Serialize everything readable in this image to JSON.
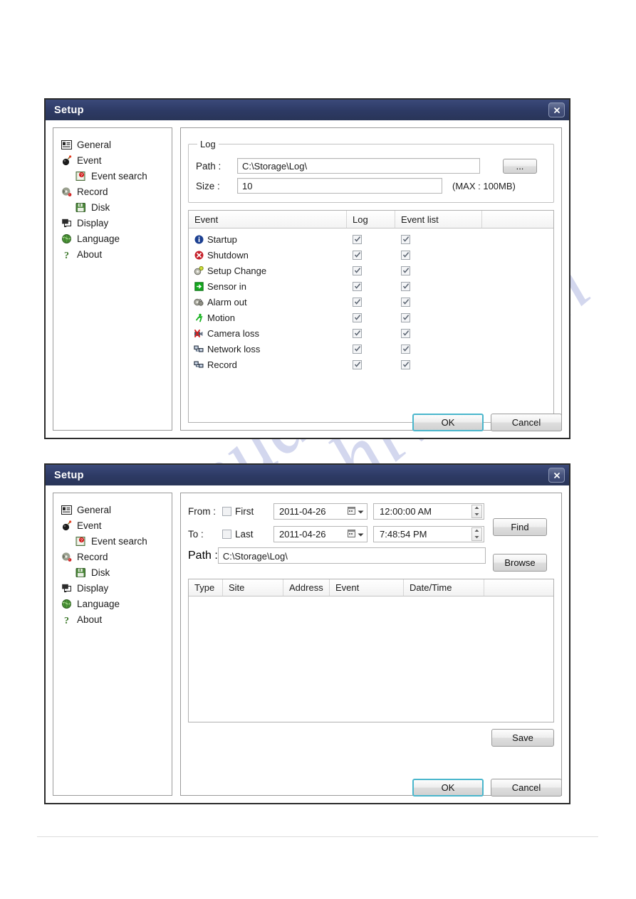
{
  "watermark": {
    "line1": "manualshive",
    "line2": "shive.com"
  },
  "dialogs": [
    {
      "title": "Setup",
      "close_icon": "close-icon",
      "sidebar": [
        {
          "label": "General",
          "icon": "general-icon",
          "indent": false
        },
        {
          "label": "Event",
          "icon": "event-bomb-icon",
          "indent": false
        },
        {
          "label": "Event search",
          "icon": "event-search-icon",
          "indent": true
        },
        {
          "label": "Record",
          "icon": "record-icon",
          "indent": false
        },
        {
          "label": "Disk",
          "icon": "disk-icon",
          "indent": true
        },
        {
          "label": "Display",
          "icon": "display-icon",
          "indent": false
        },
        {
          "label": "Language",
          "icon": "language-globe-icon",
          "indent": false
        },
        {
          "label": "About",
          "icon": "about-help-icon",
          "indent": false
        }
      ],
      "log_group": {
        "legend": "Log",
        "path_label": "Path :",
        "path_value": "C:\\Storage\\Log\\",
        "browse_label": "...",
        "size_label": "Size :",
        "size_value": "10",
        "max_note": "(MAX : 100MB)"
      },
      "event_table": {
        "columns": [
          "Event",
          "Log",
          "Event list",
          ""
        ],
        "rows": [
          {
            "name": "Startup",
            "icon": "info-circle-icon",
            "log": true,
            "event_list": true
          },
          {
            "name": "Shutdown",
            "icon": "error-circle-icon",
            "log": true,
            "event_list": true
          },
          {
            "name": "Setup Change",
            "icon": "gear-settings-icon",
            "log": true,
            "event_list": true
          },
          {
            "name": "Sensor in",
            "icon": "sensor-arrow-icon",
            "log": true,
            "event_list": true
          },
          {
            "name": "Alarm out",
            "icon": "alarm-gear-icon",
            "log": true,
            "event_list": true
          },
          {
            "name": "Motion",
            "icon": "motion-runner-icon",
            "log": true,
            "event_list": true
          },
          {
            "name": "Camera loss",
            "icon": "camera-loss-icon",
            "log": true,
            "event_list": true
          },
          {
            "name": "Network loss",
            "icon": "network-loss-icon",
            "log": true,
            "event_list": true
          },
          {
            "name": "Record",
            "icon": "network-record-icon",
            "log": true,
            "event_list": true
          }
        ]
      },
      "footer": {
        "ok": "OK",
        "cancel": "Cancel"
      }
    },
    {
      "title": "Setup",
      "close_icon": "close-icon",
      "sidebar": [
        {
          "label": "General",
          "icon": "general-icon",
          "indent": false
        },
        {
          "label": "Event",
          "icon": "event-bomb-icon",
          "indent": false
        },
        {
          "label": "Event search",
          "icon": "event-search-icon",
          "indent": true
        },
        {
          "label": "Record",
          "icon": "record-icon",
          "indent": false
        },
        {
          "label": "Disk",
          "icon": "disk-icon",
          "indent": true
        },
        {
          "label": "Display",
          "icon": "display-icon",
          "indent": false
        },
        {
          "label": "Language",
          "icon": "language-globe-icon",
          "indent": false
        },
        {
          "label": "About",
          "icon": "about-help-icon",
          "indent": false
        }
      ],
      "search": {
        "from_label": "From :",
        "from_checkbox_label": "First",
        "from_checked": false,
        "from_date": "2011-04-26",
        "from_time": "12:00:00 AM",
        "to_label": "To :",
        "to_checkbox_label": "Last",
        "to_checked": false,
        "to_date": "2011-04-26",
        "to_time": "7:48:54 PM",
        "path_label": "Path  :",
        "path_value": "C:\\Storage\\Log\\",
        "find_label": "Find",
        "browse_label": "Browse"
      },
      "results_table": {
        "columns": [
          "Type",
          "Site",
          "Address",
          "Event",
          "Date/Time",
          ""
        ],
        "rows": []
      },
      "save_label": "Save",
      "footer": {
        "ok": "OK",
        "cancel": "Cancel"
      }
    }
  ]
}
